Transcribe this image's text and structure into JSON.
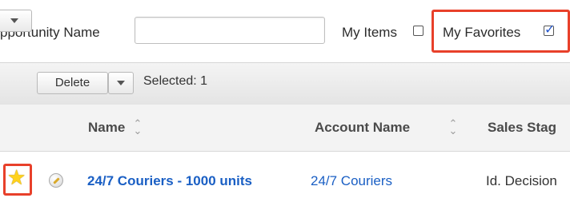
{
  "filter": {
    "name_label": "pportunity Name",
    "name_value": "",
    "my_items_label": "My Items",
    "my_items_checked": false,
    "my_favorites_label": "My Favorites",
    "my_favorites_checked": true
  },
  "actions": {
    "delete_label": "Delete",
    "selected_text": "Selected: 1"
  },
  "columns": {
    "name": "Name",
    "account_name": "Account Name",
    "sales_stage": "Sales Stag"
  },
  "rows": [
    {
      "favorite": true,
      "name": "24/7 Couriers - 1000 units",
      "account": "24/7 Couriers",
      "stage": "Id. Decision"
    }
  ],
  "colors": {
    "link": "#1a5fc4",
    "highlight": "#e8402a",
    "star": "#ffd21c"
  }
}
